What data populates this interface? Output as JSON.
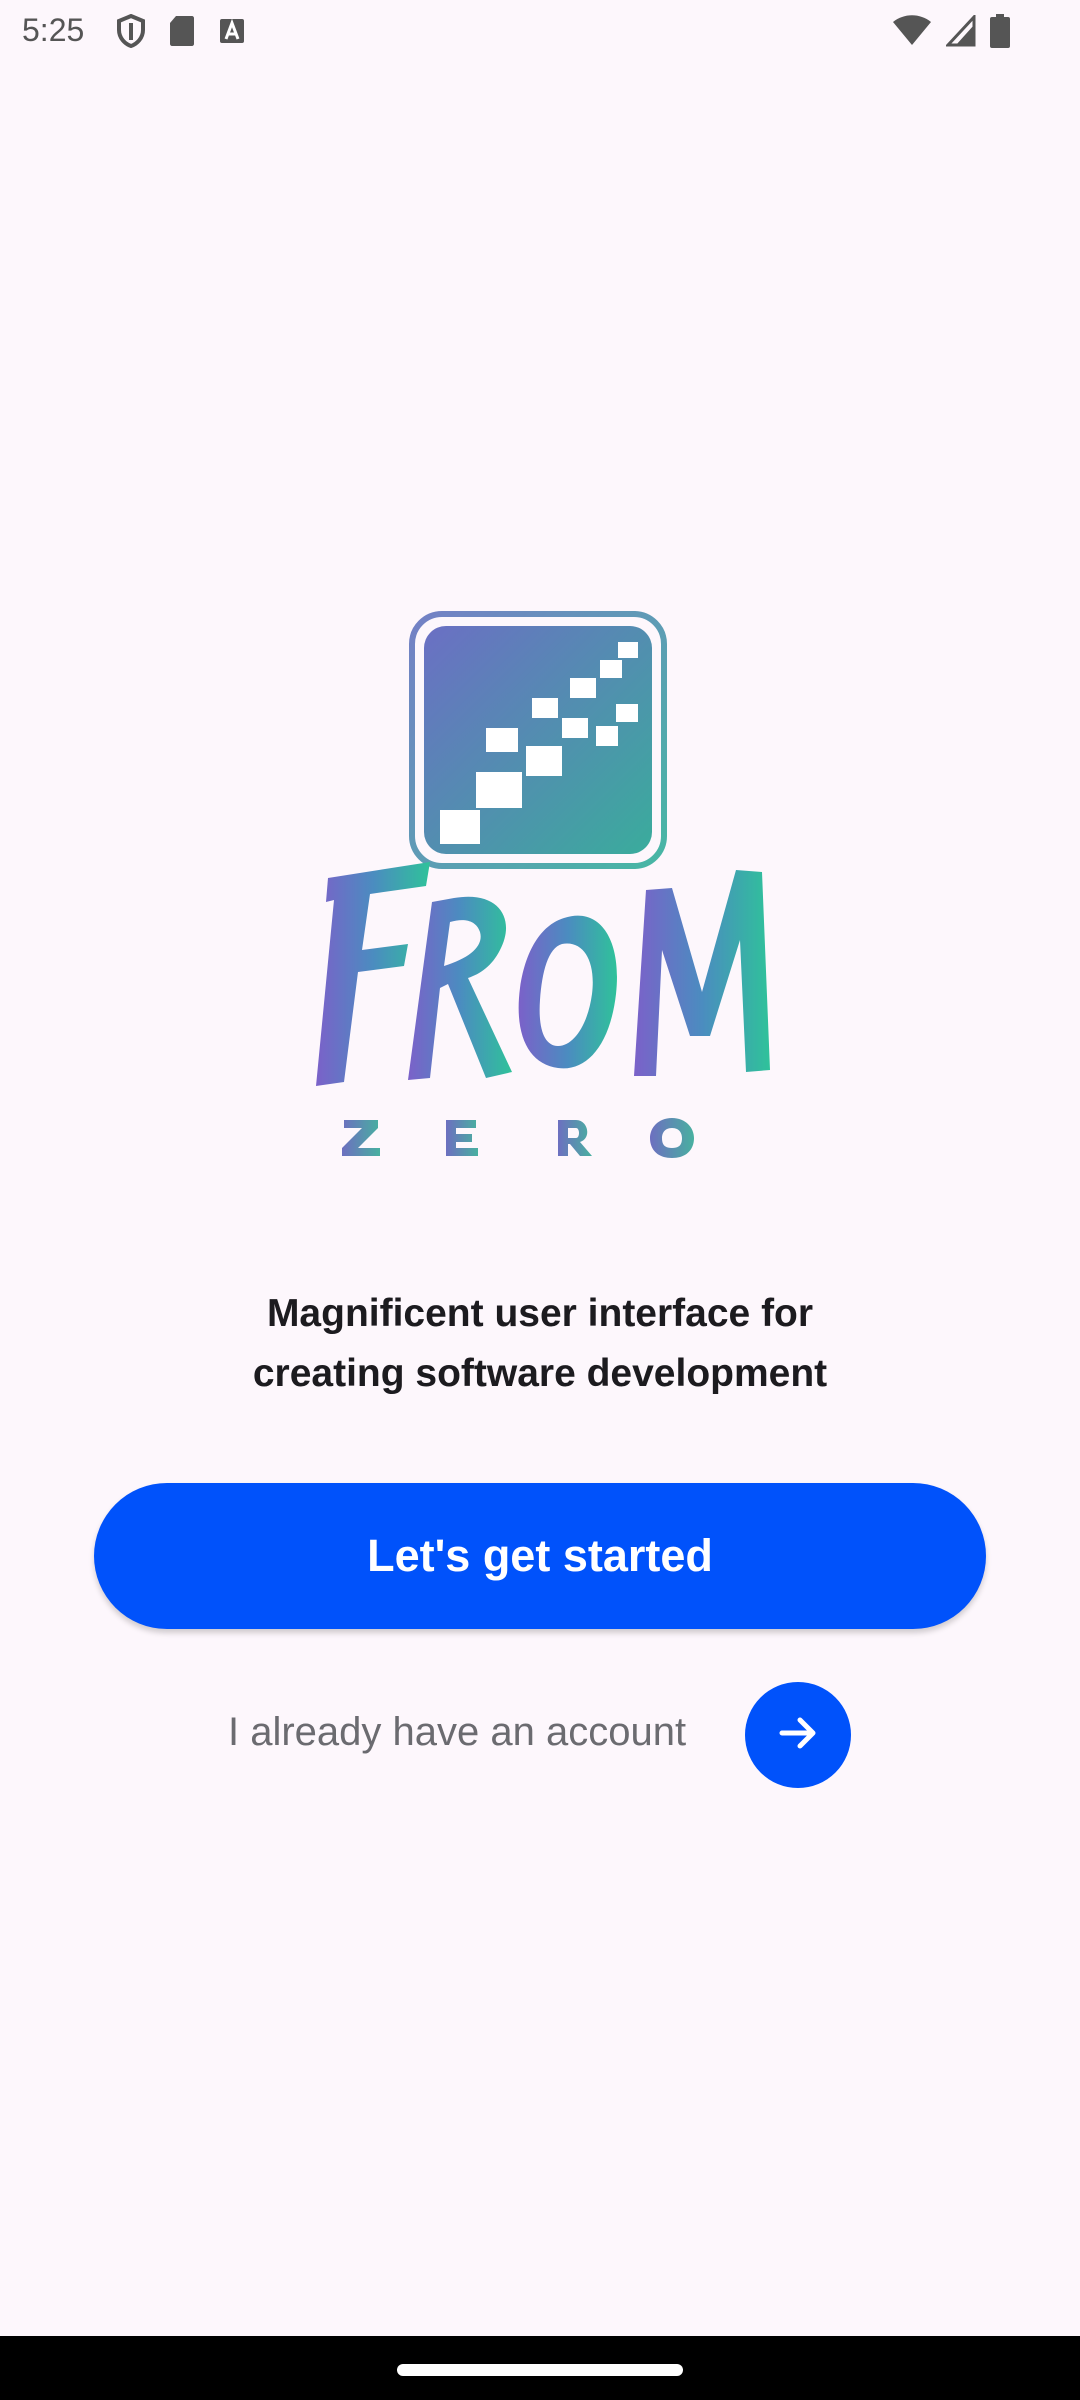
{
  "status_bar": {
    "time": "5:25",
    "icons": [
      "shield-icon",
      "sd-card-icon",
      "a-box-icon",
      "wifi-icon",
      "signal-icon",
      "battery-icon"
    ]
  },
  "logo": {
    "wordmark": "FROM",
    "subtext": "ZERO",
    "colors": {
      "gradient_start": "#7b61c9",
      "gradient_end": "#2fc29a"
    }
  },
  "tagline": {
    "line1": "Magnificent user interface for",
    "line2": "creating software development"
  },
  "primary_button": {
    "label": "Let's get started"
  },
  "secondary": {
    "label": "I already have an account",
    "arrow_icon": "arrow-right-icon"
  },
  "colors": {
    "accent": "#0052fb",
    "background": "#fdf7fc"
  }
}
